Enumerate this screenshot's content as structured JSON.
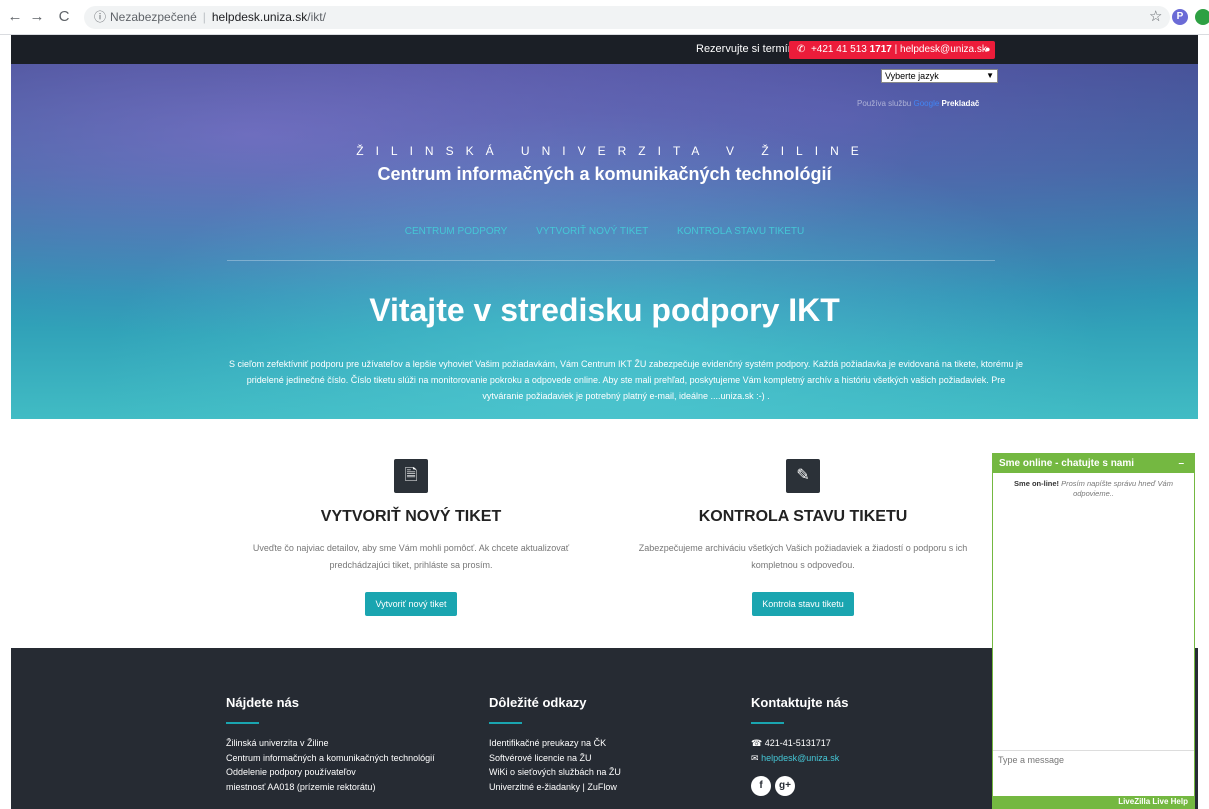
{
  "browser": {
    "security": "Nezabezpečené",
    "domain": "helpdesk.uniza.sk",
    "path": "/ikt/",
    "profile_initial": "P"
  },
  "topbar": {
    "reserve": "Rezervujte si termín",
    "phone_prefix": "+421 41 513 ",
    "phone_bold": "1717",
    "email": " | helpdesk@uniza.sk"
  },
  "translate": {
    "select_value": "Vyberte jazyk",
    "powered_by": "Používa službu",
    "google": "Google",
    "translator": "Prekladač"
  },
  "hero": {
    "university": "ŽILINSKÁ UNIVERZITA V ŽILINE",
    "centre": "Centrum  informačných a komunikačných technológií",
    "nav": [
      "CENTRUM PODPORY",
      "VYTVORIŤ NOVÝ TIKET",
      "KONTROLA STAVU TIKETU"
    ],
    "title": "Vitajte v stredisku podpory IKT",
    "text": "S cieľom zefektívniť podporu pre užívateľov a lepšie vyhovieť Vašim požiadavkám, Vám Centrum IKT ŽU zabezpečuje evidenčný systém podpory. Každá požiadavka je evidovaná na tikete, ktorému je pridelené jedinečné číslo. Číslo tiketu slúži na monitorovanie pokroku a odpovede online. Aby ste mali prehľad, poskytujeme Vám kompletný archív a históriu všetkých vašich požiadaviek. Pre vytváranie požiadaviek je potrebný platný e-mail, ideálne ....uniza.sk :-) ."
  },
  "features": [
    {
      "title": "VYTVORIŤ NOVÝ TIKET",
      "text": "Uveďte čo najviac detailov, aby sme Vám mohli pomôcť. Ak chcete aktualizovať predchádzajúci tiket, prihláste sa prosím.",
      "button": "Vytvoriť nový tiket"
    },
    {
      "title": "KONTROLA STAVU TIKETU",
      "text": "Zabezpečujeme archiváciu všetkých Vašich požiadaviek a žiadostí o podporu s ich kompletnou s odpoveďou.",
      "button": "Kontrola stavu tiketu"
    }
  ],
  "footer": {
    "find_us": {
      "title": "Nájdete nás",
      "items": [
        "Žilinská univerzita v Žiline",
        "Centrum informačných a komunikačných technológií",
        "Oddelenie podpory používateľov",
        "miestnosť AA018 (prízemie rektorátu)"
      ]
    },
    "links": {
      "title": "Dôležité odkazy",
      "items": [
        "Identifikačné preukazy na ČK",
        "Softvérové licencie na ŽU",
        "WiKi o sieťových službách na ŽU",
        "Univerzitné e-žiadanky | ZuFlow"
      ]
    },
    "contact": {
      "title": "Kontaktujte nás",
      "phone": "421-41-5131717",
      "email": "helpdesk@uniza.sk"
    }
  },
  "chat": {
    "header": "Sme online - chatujte s nami",
    "minimize": "–",
    "online": "Sme on-line!",
    "message": "Prosím napíšte správu hneď Vám odpovieme..",
    "placeholder": "Type a message",
    "brand": "LiveZilla Live Help"
  }
}
